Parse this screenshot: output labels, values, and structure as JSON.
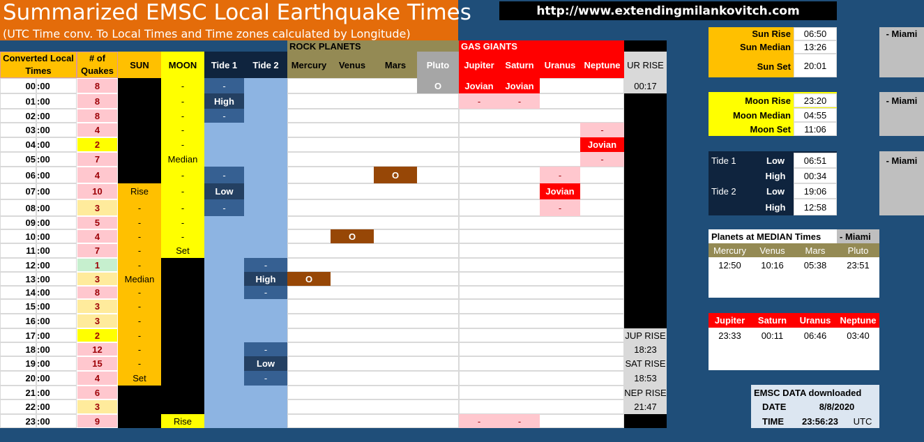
{
  "title": "Summarized EMSC Local Earthquake Times",
  "subtitle": "(UTC Time conv. To Local Times and Time zones calculated by Longitude)",
  "url": "http://www.extendingmilankovitch.com",
  "colors": {
    "background": "#1f4e79",
    "title_bg": "#e46c0a",
    "sun": "#ffc000",
    "moon": "#ffff00",
    "tide_dark": "#244062",
    "tide_light": "#8db4e2",
    "rock_header": "#948a54",
    "pluto": "#a6a6a6",
    "gas_red": "#ff0000",
    "pink": "#ffc7ce",
    "quake_pink": "#ffc7ce",
    "quake_yellow": "#ffff00",
    "quake_cream": "#ffeb9c",
    "quake_green": "#c6efce",
    "planet_brown": "#974706",
    "nav": "#0f243e"
  },
  "grid": {
    "group_rock": "ROCK PLANETS",
    "group_gas": "GAS GIANTS",
    "headers": {
      "local_time": "Converted Local Times",
      "quakes": "# of Quakes",
      "sun": "SUN",
      "moon": "MOON",
      "tide1": "Tide 1",
      "tide2": "Tide 2",
      "mercury": "Mercury",
      "venus": "Venus",
      "mars": "Mars",
      "pluto": "Pluto",
      "jupiter": "Jupiter",
      "saturn": "Saturn",
      "uranus": "Uranus",
      "neptune": "Neptune",
      "ur_rise": "UR RISE"
    },
    "rows": [
      {
        "hour": "00",
        "min": ":00",
        "quakes": "8",
        "q": "pink",
        "sun": "",
        "sunc": "black",
        "moon": "-",
        "moonc": "y",
        "t1": "-",
        "t1c": "dark",
        "t2": "",
        "t2c": "light"
      },
      {
        "hour": "01",
        "min": ":00",
        "quakes": "8",
        "q": "pink",
        "sun": "",
        "sunc": "black",
        "moon": "-",
        "moonc": "y",
        "t1": "High",
        "t1c": "navy",
        "t2": "",
        "t2c": "light"
      },
      {
        "hour": "02",
        "min": ":00",
        "quakes": "8",
        "q": "pink",
        "sun": "",
        "sunc": "black",
        "moon": "-",
        "moonc": "y",
        "t1": "-",
        "t1c": "dark",
        "t2": "",
        "t2c": "light"
      },
      {
        "hour": "03",
        "min": ":00",
        "quakes": "4",
        "q": "pink",
        "sun": "",
        "sunc": "black",
        "moon": "-",
        "moonc": "y",
        "t1": "",
        "t1c": "light",
        "t2": "",
        "t2c": "light"
      },
      {
        "hour": "04",
        "min": ":00",
        "quakes": "2",
        "q": "yellow",
        "sun": "",
        "sunc": "black",
        "moon": "-",
        "moonc": "y",
        "t1": "",
        "t1c": "light",
        "t2": "",
        "t2c": "light"
      },
      {
        "hour": "05",
        "min": ":00",
        "quakes": "7",
        "q": "pink",
        "sun": "",
        "sunc": "black",
        "moon": "Median",
        "moonc": "y",
        "t1": "",
        "t1c": "light",
        "t2": "",
        "t2c": "light"
      },
      {
        "hour": "06",
        "min": ":00",
        "quakes": "4",
        "q": "pink",
        "sun": "",
        "sunc": "black",
        "moon": "-",
        "moonc": "y",
        "t1": "-",
        "t1c": "dark",
        "t2": "",
        "t2c": "light"
      },
      {
        "hour": "07",
        "min": ":00",
        "quakes": "10",
        "q": "pink",
        "sun": "Rise",
        "sunc": "o",
        "moon": "-",
        "moonc": "y",
        "t1": "Low",
        "t1c": "navy",
        "t2": "",
        "t2c": "light"
      },
      {
        "hour": "08",
        "min": ":00",
        "quakes": "3",
        "q": "cream",
        "sun": "-",
        "sunc": "o",
        "moon": "-",
        "moonc": "y",
        "t1": "-",
        "t1c": "dark",
        "t2": "",
        "t2c": "light"
      },
      {
        "hour": "09",
        "min": ":00",
        "quakes": "5",
        "q": "pink",
        "sun": "-",
        "sunc": "o",
        "moon": "-",
        "moonc": "y",
        "t1": "",
        "t1c": "light",
        "t2": "",
        "t2c": "light"
      },
      {
        "hour": "10",
        "min": ":00",
        "quakes": "4",
        "q": "pink",
        "sun": "-",
        "sunc": "o",
        "moon": "-",
        "moonc": "y",
        "t1": "",
        "t1c": "light",
        "t2": "",
        "t2c": "light"
      },
      {
        "hour": "11",
        "min": ":00",
        "quakes": "7",
        "q": "pink",
        "sun": "-",
        "sunc": "o",
        "moon": "Set",
        "moonc": "y",
        "t1": "",
        "t1c": "light",
        "t2": "",
        "t2c": "light"
      },
      {
        "hour": "12",
        "min": ":00",
        "quakes": "1",
        "q": "green",
        "sun": "-",
        "sunc": "o",
        "moon": "",
        "moonc": "black",
        "t1": "",
        "t1c": "light",
        "t2": "-",
        "t2c": "dark"
      },
      {
        "hour": "13",
        "min": ":00",
        "quakes": "3",
        "q": "cream",
        "sun": "Median",
        "sunc": "o",
        "moon": "",
        "moonc": "black",
        "t1": "",
        "t1c": "light",
        "t2": "High",
        "t2c": "navy"
      },
      {
        "hour": "14",
        "min": ":00",
        "quakes": "8",
        "q": "pink",
        "sun": "-",
        "sunc": "o",
        "moon": "",
        "moonc": "black",
        "t1": "",
        "t1c": "light",
        "t2": "-",
        "t2c": "dark"
      },
      {
        "hour": "15",
        "min": ":00",
        "quakes": "3",
        "q": "cream",
        "sun": "-",
        "sunc": "o",
        "moon": "",
        "moonc": "black",
        "t1": "",
        "t1c": "light",
        "t2": "",
        "t2c": "light"
      },
      {
        "hour": "16",
        "min": ":00",
        "quakes": "3",
        "q": "cream",
        "sun": "-",
        "sunc": "o",
        "moon": "",
        "moonc": "black",
        "t1": "",
        "t1c": "light",
        "t2": "",
        "t2c": "light"
      },
      {
        "hour": "17",
        "min": ":00",
        "quakes": "2",
        "q": "yellow",
        "sun": "-",
        "sunc": "o",
        "moon": "",
        "moonc": "black",
        "t1": "",
        "t1c": "light",
        "t2": "",
        "t2c": "light"
      },
      {
        "hour": "18",
        "min": ":00",
        "quakes": "12",
        "q": "pink",
        "sun": "-",
        "sunc": "o",
        "moon": "",
        "moonc": "black",
        "t1": "",
        "t1c": "light",
        "t2": "-",
        "t2c": "dark"
      },
      {
        "hour": "19",
        "min": ":00",
        "quakes": "15",
        "q": "pink",
        "sun": "-",
        "sunc": "o",
        "moon": "",
        "moonc": "black",
        "t1": "",
        "t1c": "light",
        "t2": "Low",
        "t2c": "navy"
      },
      {
        "hour": "20",
        "min": ":00",
        "quakes": "4",
        "q": "pink",
        "sun": "Set",
        "sunc": "o",
        "moon": "",
        "moonc": "black",
        "t1": "",
        "t1c": "light",
        "t2": "-",
        "t2c": "dark"
      },
      {
        "hour": "21",
        "min": ":00",
        "quakes": "6",
        "q": "pink",
        "sun": "",
        "sunc": "black",
        "moon": "",
        "moonc": "black",
        "t1": "",
        "t1c": "light",
        "t2": "",
        "t2c": "light"
      },
      {
        "hour": "22",
        "min": ":00",
        "quakes": "3",
        "q": "cream",
        "sun": "",
        "sunc": "black",
        "moon": "",
        "moonc": "black",
        "t1": "",
        "t1c": "light",
        "t2": "",
        "t2c": "light"
      },
      {
        "hour": "23",
        "min": ":00",
        "quakes": "9",
        "q": "pink",
        "sun": "",
        "sunc": "black",
        "moon": "Rise",
        "moonc": "y",
        "t1": "",
        "t1c": "light",
        "t2": "",
        "t2c": "light"
      }
    ],
    "planet_marks": [
      {
        "row": 0,
        "col": "pluto",
        "text": "O",
        "style": "pluto"
      },
      {
        "row": 0,
        "col": "jupiter",
        "text": "Jovian",
        "style": "red"
      },
      {
        "row": 0,
        "col": "saturn",
        "text": "Jovian",
        "style": "red"
      },
      {
        "row": 1,
        "col": "jupiter",
        "text": "-",
        "style": "pink"
      },
      {
        "row": 1,
        "col": "saturn",
        "text": "-",
        "style": "pink"
      },
      {
        "row": 3,
        "col": "neptune",
        "text": "-",
        "style": "pink"
      },
      {
        "row": 4,
        "col": "neptune",
        "text": "Jovian",
        "style": "red"
      },
      {
        "row": 5,
        "col": "neptune",
        "text": "-",
        "style": "pink"
      },
      {
        "row": 6,
        "col": "mars",
        "text": "O",
        "style": "brown"
      },
      {
        "row": 6,
        "col": "uranus",
        "text": "-",
        "style": "pink"
      },
      {
        "row": 7,
        "col": "uranus",
        "text": "Jovian",
        "style": "red"
      },
      {
        "row": 8,
        "col": "uranus",
        "text": "-",
        "style": "pink"
      },
      {
        "row": 10,
        "col": "venus",
        "text": "O",
        "style": "brown"
      },
      {
        "row": 13,
        "col": "mercury",
        "text": "O",
        "style": "brown"
      },
      {
        "row": 23,
        "col": "jupiter",
        "text": "-",
        "style": "pink"
      },
      {
        "row": 23,
        "col": "saturn",
        "text": "-",
        "style": "pink"
      }
    ],
    "rise_column": [
      {
        "row": 0,
        "text": "00:17",
        "style": "gray"
      },
      {
        "row": 17,
        "text": "JUP RISE",
        "style": "gray"
      },
      {
        "row": 18,
        "text": "18:23",
        "style": "gray"
      },
      {
        "row": 19,
        "text": "SAT RISE",
        "style": "gray"
      },
      {
        "row": 20,
        "text": "18:53",
        "style": "gray"
      },
      {
        "row": 21,
        "text": "NEP RISE",
        "style": "gray"
      },
      {
        "row": 22,
        "text": "21:47",
        "style": "gray"
      }
    ]
  },
  "sun_panel": {
    "rise_label": "Sun Rise",
    "rise": "06:50",
    "median_label": "Sun Median",
    "median": "13:26",
    "set_label": "Sun Set",
    "set": "20:01",
    "location": "- Miami"
  },
  "moon_panel": {
    "rise_label": "Moon Rise",
    "rise": "23:20",
    "median_label": "Moon Median",
    "median": "04:55",
    "set_label": "Moon Set",
    "set": "11:06",
    "location": "- Miami"
  },
  "tide_panel": {
    "tide1": "Tide 1",
    "tide2": "Tide 2",
    "low": "Low",
    "high": "High",
    "t1_low": "06:51",
    "t1_high": "00:34",
    "t2_low": "19:06",
    "t2_high": "12:58",
    "location": "- Miami"
  },
  "median_panel": {
    "title": "Planets at MEDIAN Times",
    "location": "- Miami",
    "planets": [
      "Mercury",
      "Venus",
      "Mars",
      "Pluto"
    ],
    "times": [
      "12:50",
      "10:16",
      "05:38",
      "23:51"
    ]
  },
  "gas_panel": {
    "planets": [
      "Jupiter",
      "Saturn",
      "Uranus",
      "Neptune"
    ],
    "times": [
      "23:33",
      "00:11",
      "06:46",
      "03:40"
    ]
  },
  "emsc_panel": {
    "title": "EMSC DATA downloaded",
    "date_label": "DATE",
    "date": "8/8/2020",
    "time_label": "TIME",
    "time": "23:56:23",
    "tz": "UTC"
  }
}
